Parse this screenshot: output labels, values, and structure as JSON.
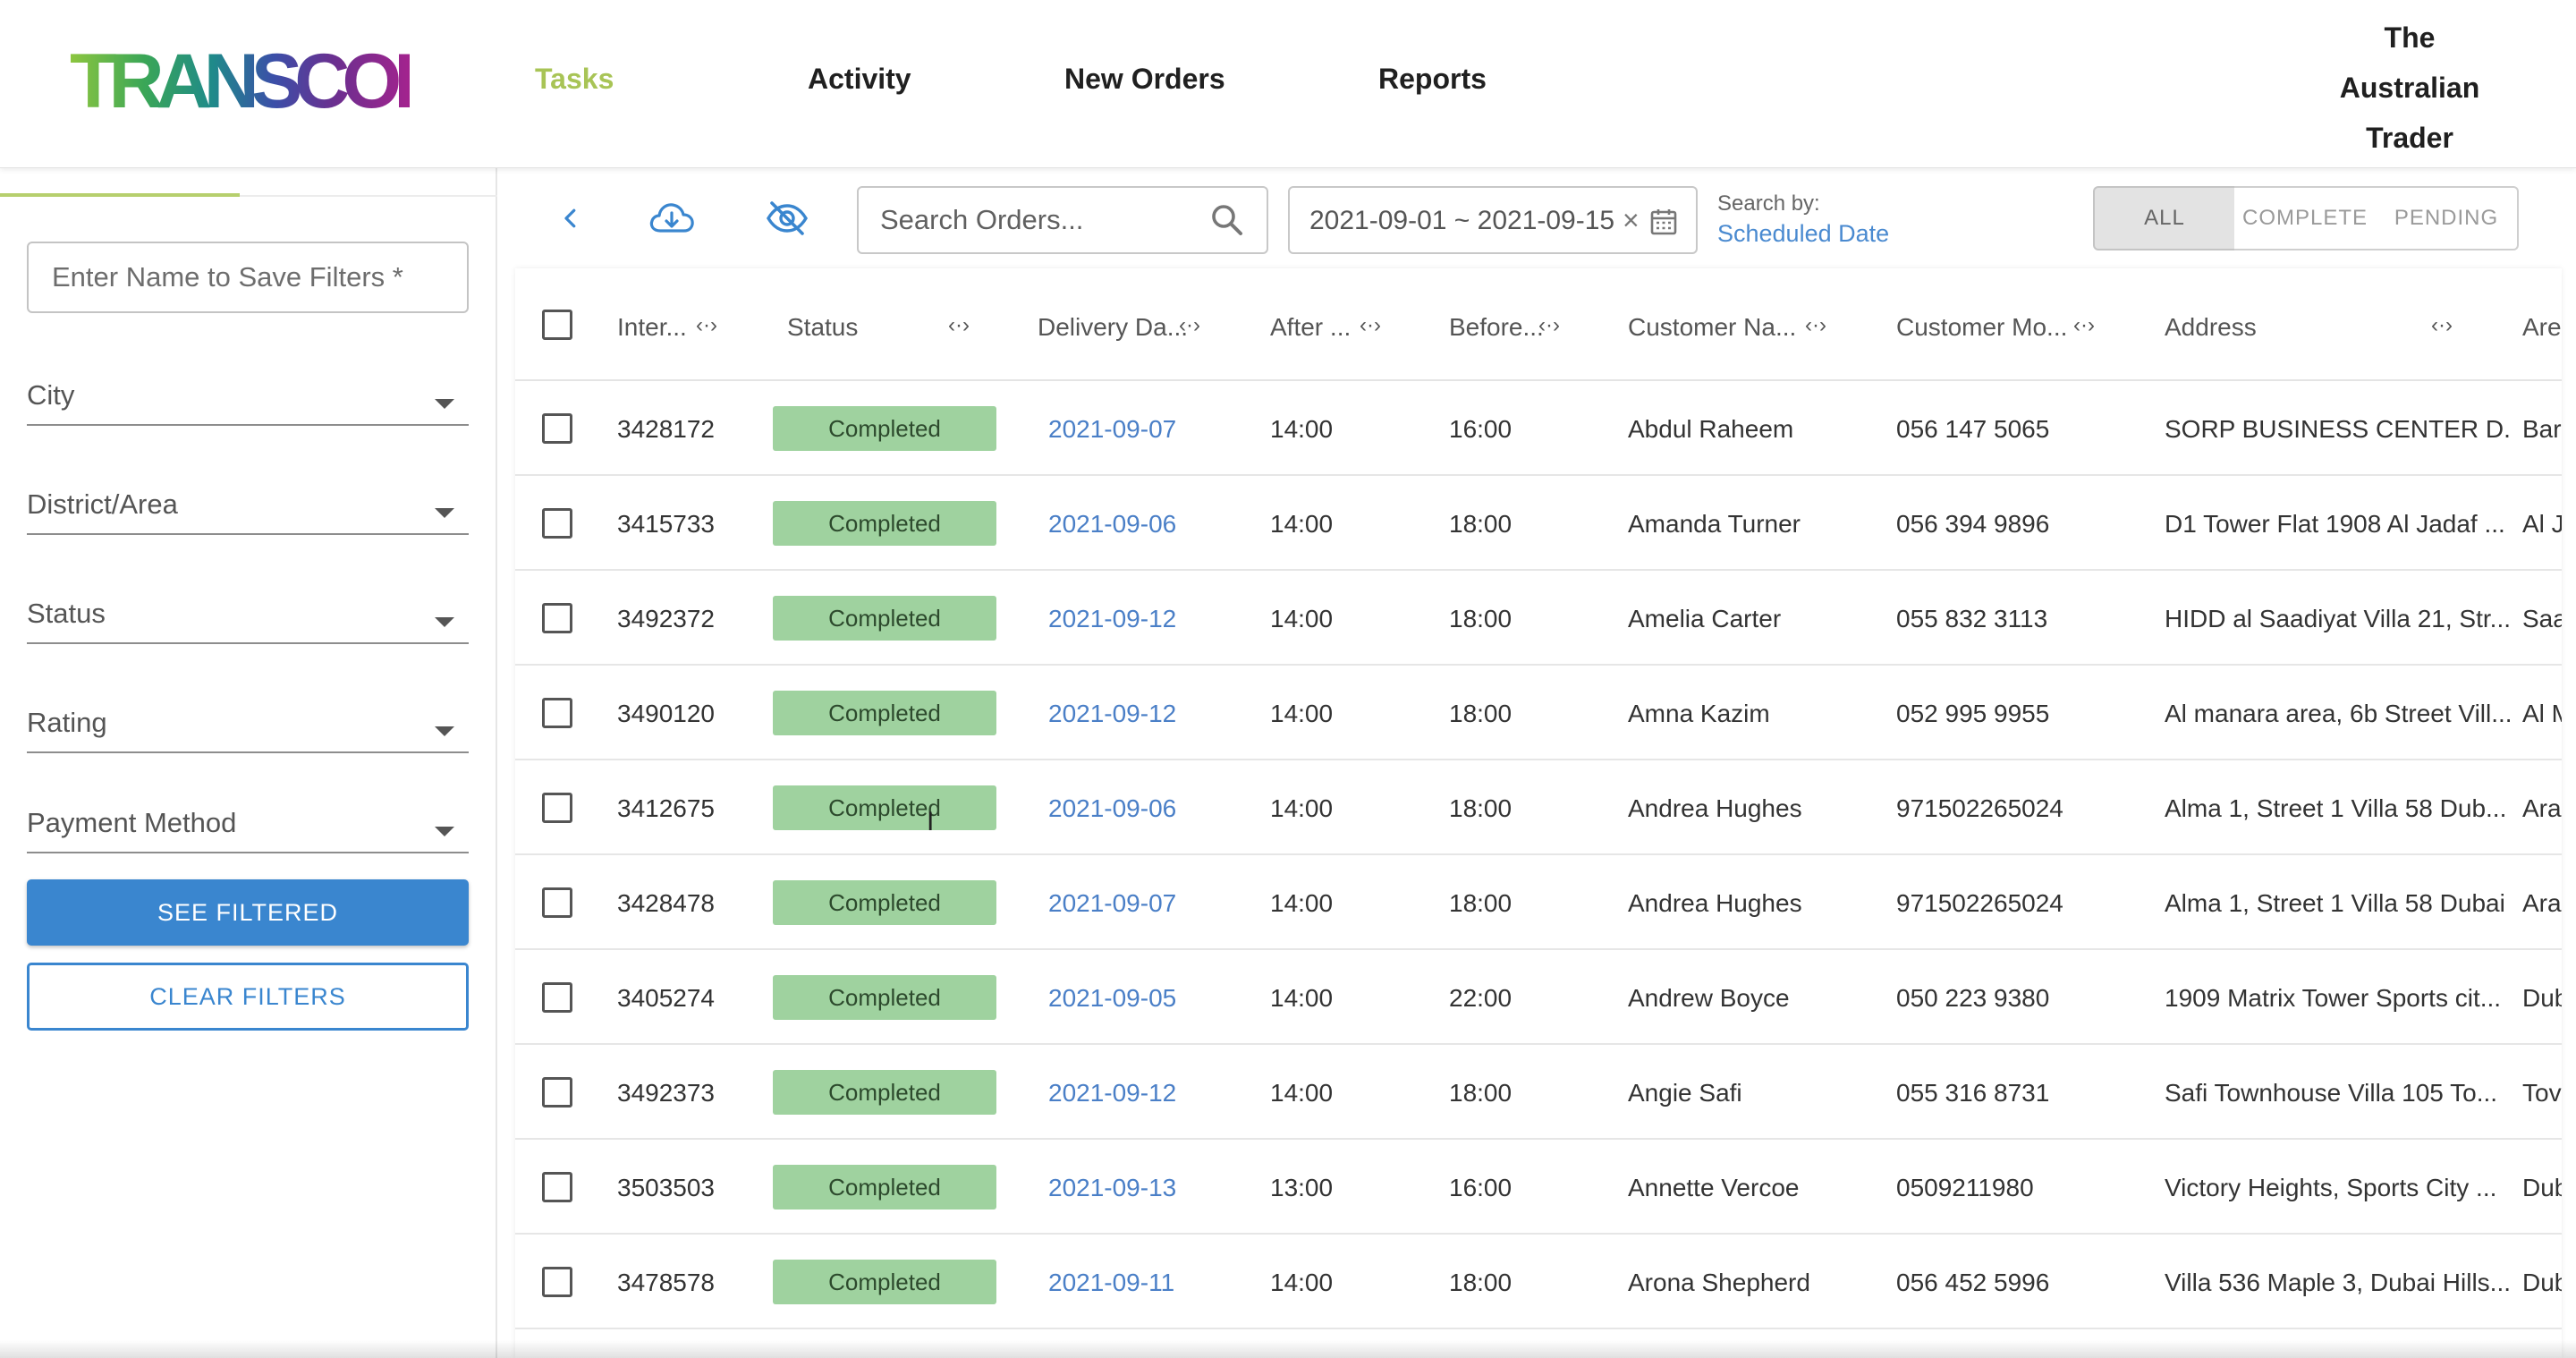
{
  "header": {
    "logo": "TRANSCORP",
    "nav": [
      "Tasks",
      "Activity",
      "New Orders",
      "Reports"
    ],
    "account": [
      "The",
      "Australian",
      "Trader"
    ]
  },
  "sidebar": {
    "save_placeholder": "Enter Name to Save Filters *",
    "selects": [
      "City",
      "District/Area",
      "Status",
      "Rating",
      "Payment Method"
    ],
    "see_filtered": "SEE FILTERED",
    "clear_filters": "CLEAR FILTERS"
  },
  "toolbar": {
    "back_icon": "chevron-left-icon",
    "download_icon": "cloud-download-icon",
    "hide_icon": "eye-off-icon",
    "search_placeholder": "Search Orders...",
    "date_range": "2021-09-01 ~ 2021-09-15",
    "date_clear": "×",
    "search_by_label": "Search by:",
    "search_by_value": "Scheduled Date",
    "filters": [
      "ALL",
      "COMPLETE",
      "PENDING"
    ],
    "active_filter": "ALL"
  },
  "colors": {
    "accent": "#a8c456",
    "primary_blue": "#3a86cf",
    "status_green": "#9fd29f"
  },
  "table": {
    "columns": [
      "Inter...",
      "Status",
      "Delivery Da...",
      "After ...",
      "Before...",
      "Customer Na...",
      "Customer Mo...",
      "Address",
      "Are"
    ],
    "rows": [
      {
        "id": "3428172",
        "status": "Completed",
        "date": "2021-09-07",
        "after": "14:00",
        "before": "16:00",
        "name": "Abdul Raheem",
        "mobile": "056 147 5065",
        "address": "SORP BUSINESS CENTER D...",
        "area": "Bar"
      },
      {
        "id": "3415733",
        "status": "Completed",
        "date": "2021-09-06",
        "after": "14:00",
        "before": "18:00",
        "name": "Amanda Turner",
        "mobile": "056 394 9896",
        "address": "D1 Tower Flat 1908 Al Jadaf ...",
        "area": "Al J"
      },
      {
        "id": "3492372",
        "status": "Completed",
        "date": "2021-09-12",
        "after": "14:00",
        "before": "18:00",
        "name": "Amelia Carter",
        "mobile": "055 832 3113",
        "address": "HIDD al Saadiyat Villa 21, Str...",
        "area": "Saa"
      },
      {
        "id": "3490120",
        "status": "Completed",
        "date": "2021-09-12",
        "after": "14:00",
        "before": "18:00",
        "name": "Amna Kazim",
        "mobile": "052 995 9955",
        "address": "Al manara area, 6b Street Vill...",
        "area": "Al M"
      },
      {
        "id": "3412675",
        "status": "Completed",
        "date": "2021-09-06",
        "after": "14:00",
        "before": "18:00",
        "name": "Andrea Hughes",
        "mobile": "971502265024",
        "address": "Alma 1, Street 1 Villa 58 Dub...",
        "area": "Ara"
      },
      {
        "id": "3428478",
        "status": "Completed",
        "date": "2021-09-07",
        "after": "14:00",
        "before": "18:00",
        "name": "Andrea Hughes",
        "mobile": "971502265024",
        "address": "Alma 1, Street 1 Villa 58 Dubai",
        "area": "Ara"
      },
      {
        "id": "3405274",
        "status": "Completed",
        "date": "2021-09-05",
        "after": "14:00",
        "before": "22:00",
        "name": "Andrew Boyce",
        "mobile": "050 223 9380",
        "address": "1909 Matrix Tower Sports cit...",
        "area": "Dub"
      },
      {
        "id": "3492373",
        "status": "Completed",
        "date": "2021-09-12",
        "after": "14:00",
        "before": "18:00",
        "name": "Angie Safi",
        "mobile": "055 316 8731",
        "address": "Safi Townhouse Villa 105 To...",
        "area": "Tov"
      },
      {
        "id": "3503503",
        "status": "Completed",
        "date": "2021-09-13",
        "after": "13:00",
        "before": "16:00",
        "name": "Annette Vercoe",
        "mobile": "0509211980",
        "address": "Victory Heights, Sports City ...",
        "area": "Dub"
      },
      {
        "id": "3478578",
        "status": "Completed",
        "date": "2021-09-11",
        "after": "14:00",
        "before": "18:00",
        "name": "Arona Shepherd",
        "mobile": "056 452 5996",
        "address": "Villa 536 Maple 3, Dubai Hills...",
        "area": "Dub"
      }
    ]
  }
}
